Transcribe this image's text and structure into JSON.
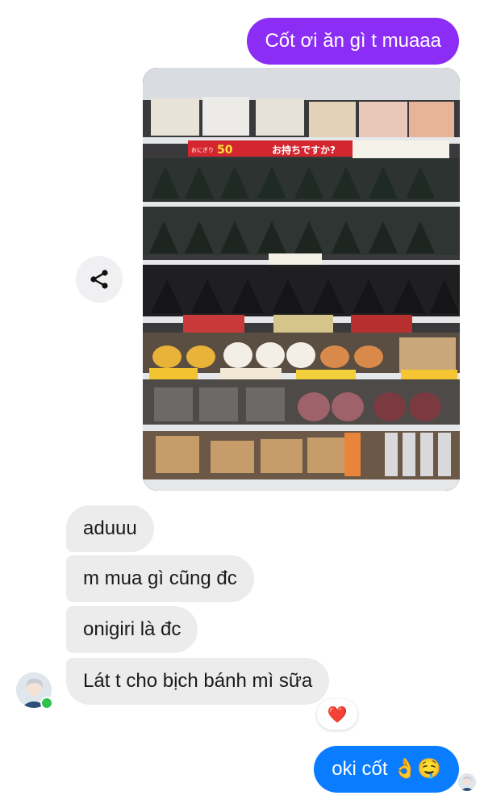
{
  "messages": {
    "outgoing_1": "Cốt ơi ăn gì t muaaa",
    "incoming": [
      "aduuu",
      "m mua gì cũng đc",
      "onigiri là đc",
      "Lát t cho bịch bánh mì sữa"
    ],
    "reaction_emoji": "❤️",
    "outgoing_2": "oki cốt 👌🤤"
  },
  "photo": {
    "signs": {
      "sign_1": "50",
      "sign_2": "お持ちですか?",
      "sign_3": "おにぎり"
    }
  },
  "icons": {
    "share": "share-icon",
    "avatar": "user-avatar",
    "online": "online-status-dot"
  },
  "colors": {
    "purple_bubble": "#8b2df5",
    "blue_bubble": "#0a7cff",
    "incoming_bubble": "#ececed",
    "online_dot": "#31c24d"
  }
}
